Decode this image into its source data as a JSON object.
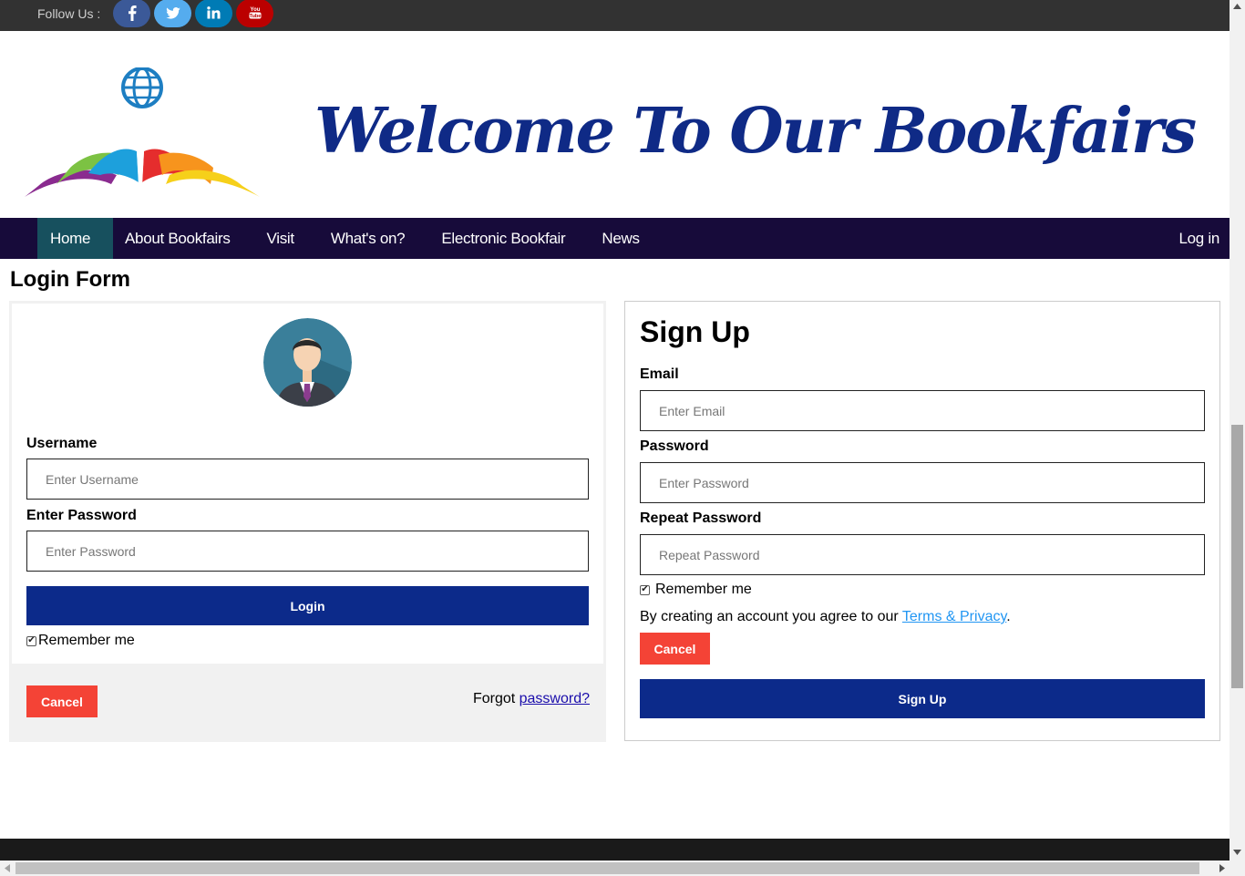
{
  "topbar": {
    "follow_label": "Follow Us :",
    "social": [
      {
        "name": "facebook-icon",
        "glyph": "f",
        "color": "#3b5998"
      },
      {
        "name": "twitter-icon",
        "glyph": "twitter",
        "color": "#55acee"
      },
      {
        "name": "linkedin-icon",
        "glyph": "in",
        "color": "#007bb5"
      },
      {
        "name": "youtube-icon",
        "glyph": "You Tube",
        "color": "#bb0000"
      }
    ]
  },
  "header": {
    "welcome_text": "Welcome To Our Bookfairs",
    "logo_icon": "book-globe-logo"
  },
  "nav": {
    "items": [
      "Home",
      "About Bookfairs",
      "Visit",
      "What's on?",
      "Electronic Bookfair",
      "News"
    ],
    "active": "Home",
    "login_label": "Log in"
  },
  "login_form": {
    "title": "Login Form",
    "username_label": "Username",
    "username_placeholder": "Enter Username",
    "password_label": "Enter Password",
    "password_placeholder": "Enter Password",
    "login_button": "Login",
    "remember_label": "Remember me",
    "remember_checked": true,
    "cancel_button": "Cancel",
    "forgot_prefix": "Forgot ",
    "forgot_link": "password?"
  },
  "signup": {
    "title": "Sign Up",
    "email_label": "Email",
    "email_placeholder": "Enter Email",
    "password_label": "Password",
    "password_placeholder": "Enter Password",
    "repeat_label": "Repeat Password",
    "repeat_placeholder": "Repeat Password",
    "remember_label": "Remember me",
    "remember_checked": true,
    "terms_prefix": "By creating an account you agree to our ",
    "terms_link": "Terms & Privacy",
    "terms_suffix": ".",
    "cancel_button": "Cancel",
    "signup_button": "Sign Up"
  },
  "colors": {
    "nav_bg": "#170b3a",
    "nav_active": "#17505e",
    "primary_button": "#0c2a8a",
    "cancel_button": "#f44336",
    "welcome_text": "#0f2a86"
  }
}
